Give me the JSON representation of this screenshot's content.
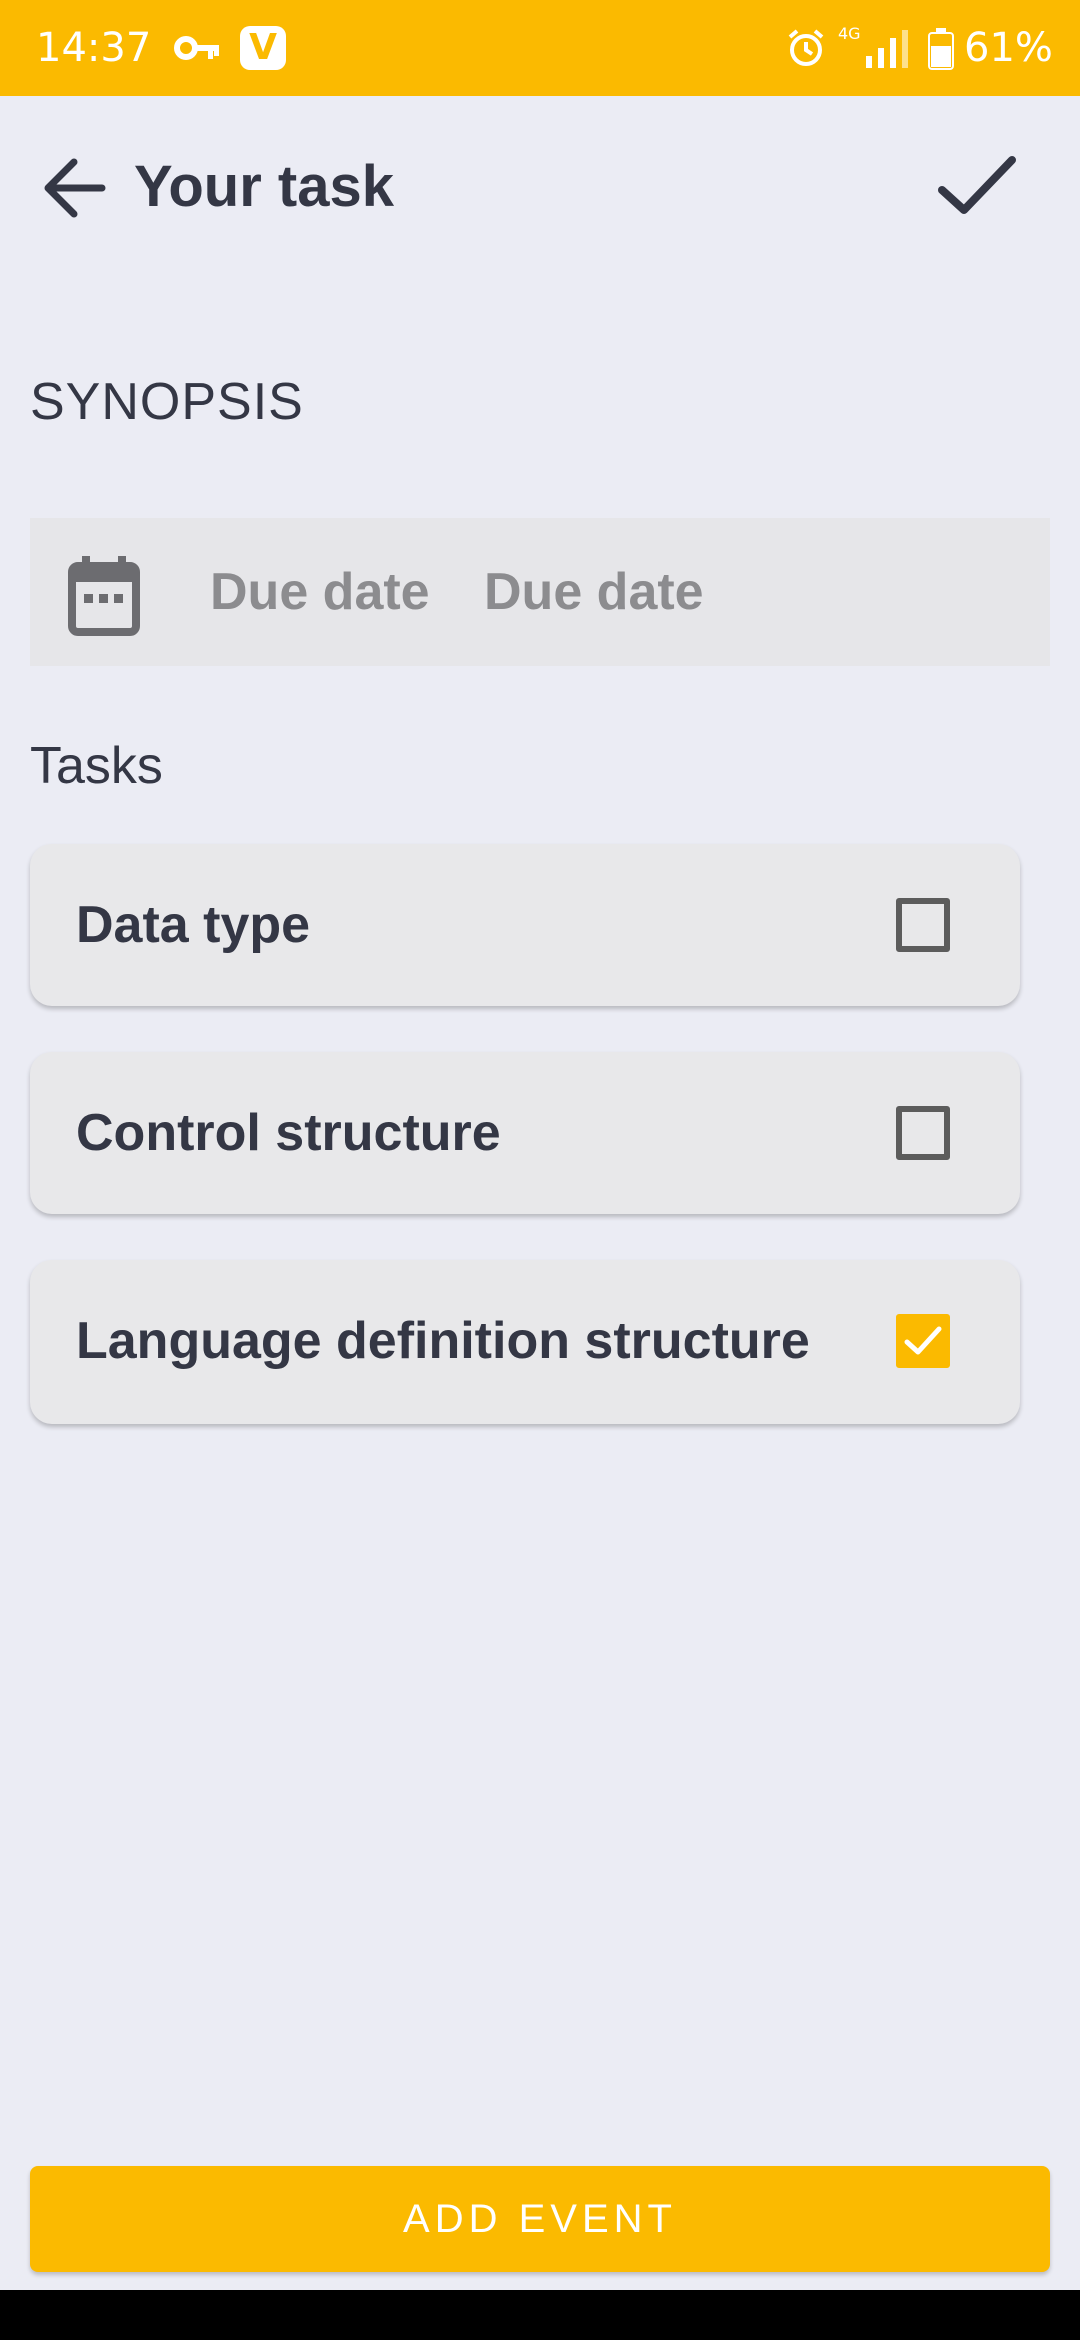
{
  "status_bar": {
    "time": "14:37",
    "app_icon_letter": "V",
    "network": "4G",
    "battery": "61%"
  },
  "app_bar": {
    "title": "Your task"
  },
  "section": {
    "synopsis_label": "SYNOPSIS"
  },
  "due": {
    "label": "Due date",
    "value": "Due date"
  },
  "tasks": {
    "header": "Tasks",
    "items": [
      {
        "label": "Data type",
        "checked": false
      },
      {
        "label": "Control structure",
        "checked": false
      },
      {
        "label": "Language definition structure",
        "checked": true
      }
    ]
  },
  "actions": {
    "add_event_label": "ADD EVENT"
  },
  "colors": {
    "accent": "#FBBA00",
    "background": "#EBECF4",
    "text": "#343745"
  }
}
